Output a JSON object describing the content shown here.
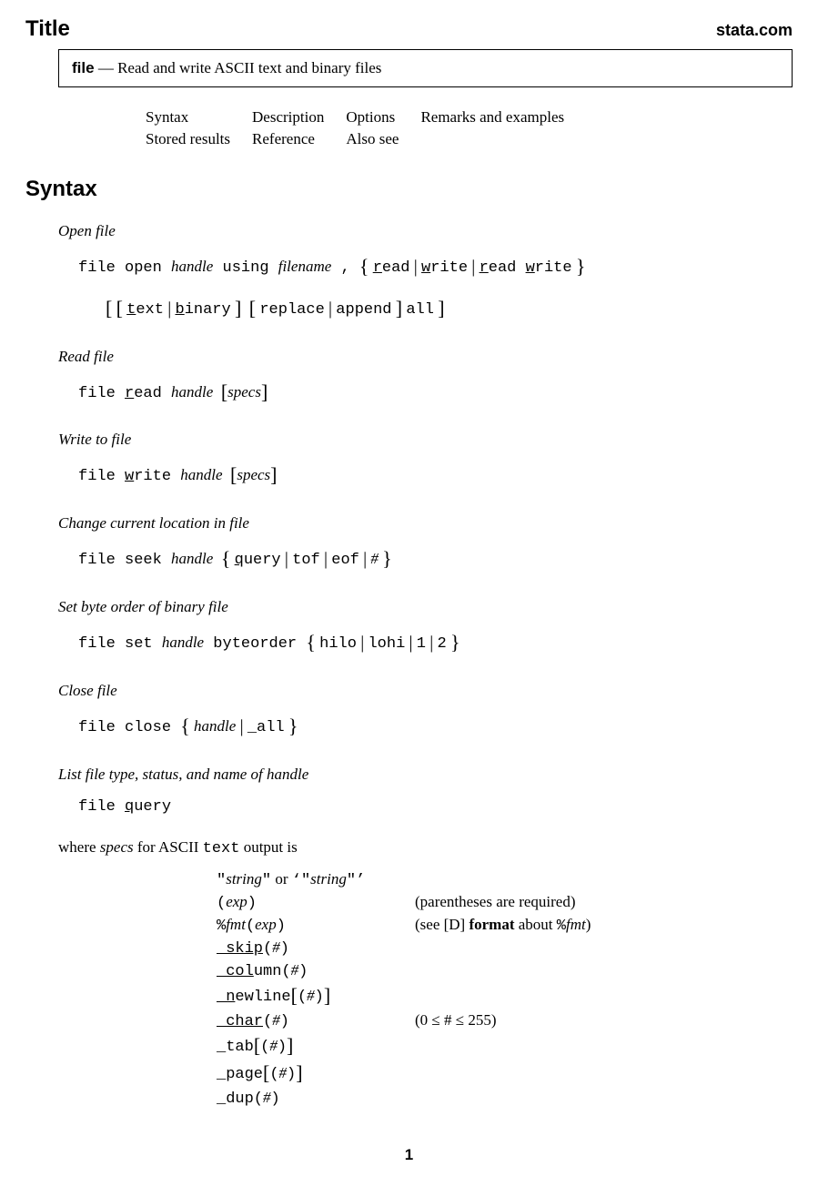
{
  "header": {
    "title_label": "Title",
    "site": "stata.com"
  },
  "title_box": {
    "cmd": "file",
    "dash": " — ",
    "desc": "Read and write ASCII text and binary files"
  },
  "toc": {
    "r1c1": "Syntax",
    "r1c2": "Description",
    "r1c3": "Options",
    "r1c4": "Remarks and examples",
    "r2c1": "Stored results",
    "r2c2": "Reference",
    "r2c3": "Also see"
  },
  "section_syntax": "Syntax",
  "open": {
    "head": "Open file",
    "kw_file": "file open ",
    "arg_handle": "handle",
    "kw_using": " using ",
    "arg_filename": "filename",
    "comma": " , ",
    "opt_read_u": "r",
    "opt_read_rest": "ead",
    "opt_write_u": "w",
    "opt_write_rest": "rite",
    "opt_rw_ru": "r",
    "opt_rw_rrest": "ead ",
    "opt_rw_wu": "w",
    "opt_rw_wrest": "rite",
    "opt_text_u": "t",
    "opt_text_rest": "ext",
    "opt_binary_u": "b",
    "opt_binary_rest": "inary",
    "opt_replace": "replace",
    "opt_append": "append",
    "opt_all": "all"
  },
  "read": {
    "head": "Read file",
    "kw_file": "file ",
    "kw_read_u": "r",
    "kw_read_rest": "ead ",
    "arg_handle": "handle",
    "arg_specs": "specs"
  },
  "write": {
    "head": "Write to file",
    "kw_file": "file ",
    "kw_write_u": "w",
    "kw_write_rest": "rite ",
    "arg_handle": "handle",
    "arg_specs": "specs"
  },
  "seek": {
    "head": "Change current location in file",
    "kw": "file seek ",
    "arg_handle": "handle",
    "opt_query_u": "q",
    "opt_query_rest": "uery",
    "opt_tof": "tof",
    "opt_eof": "eof",
    "opt_hash": "#"
  },
  "set": {
    "head": "Set byte order of binary file",
    "kw": "file set ",
    "arg_handle": "handle",
    "kw_byteorder": " byteorder ",
    "opt_hilo": "hilo",
    "opt_lohi": "lohi",
    "opt_1": "1",
    "opt_2": "2"
  },
  "close": {
    "head": "Close file",
    "kw": "file close ",
    "arg_handle": "handle",
    "opt_all": "_all"
  },
  "query": {
    "head": "List file type, status, and name of handle",
    "kw_file": "file ",
    "kw_query_u": "q",
    "kw_query_rest": "uery"
  },
  "where": {
    "pre": "where ",
    "specs": "specs",
    "mid": " for ASCII ",
    "text": "text",
    "post": " output is"
  },
  "specs": {
    "r1_a": "\"",
    "r1_b": "string",
    "r1_c": "\"",
    "r1_or": " or ",
    "r1_lq": "‘",
    "r1_d": "\"",
    "r1_e": "string",
    "r1_f": "\"",
    "r1_rq": "’",
    "r2_lp": "(",
    "r2_exp": "exp",
    "r2_rp": ")",
    "r2_note": "(parentheses are required)",
    "r3_pct": "%",
    "r3_fmt": "fmt",
    "r3_lp": "(",
    "r3_exp": "exp",
    "r3_rp": ")",
    "r3_note_a": "(see [D] ",
    "r3_note_b": "format",
    "r3_note_c": " about ",
    "r3_note_d": "%",
    "r3_note_e": "fmt",
    "r3_note_f": ")",
    "r4_u": "_skip",
    "r4_rest": "(",
    "r4_hash": "#",
    "r4_rp": ")",
    "r5_u": "_col",
    "r5_rest": "umn(",
    "r5_hash": "#",
    "r5_rp": ")",
    "r6_u": "_n",
    "r6_rest": "ewline",
    "r6_lp": "(",
    "r6_hash": "#",
    "r6_rp": ")",
    "r7_u": "_char",
    "r7_lp": "(",
    "r7_hash": "#",
    "r7_rp": ")",
    "r7_note": "(0 ≤ # ≤ 255)",
    "r8_kw": "_tab",
    "r8_lp": "(",
    "r8_hash": "#",
    "r8_rp": ")",
    "r9_kw": "_page",
    "r9_lp": "(",
    "r9_hash": "#",
    "r9_rp": ")",
    "r10_kw": "_dup(",
    "r10_hash": "#",
    "r10_rp": ")"
  },
  "pagenum": "1"
}
